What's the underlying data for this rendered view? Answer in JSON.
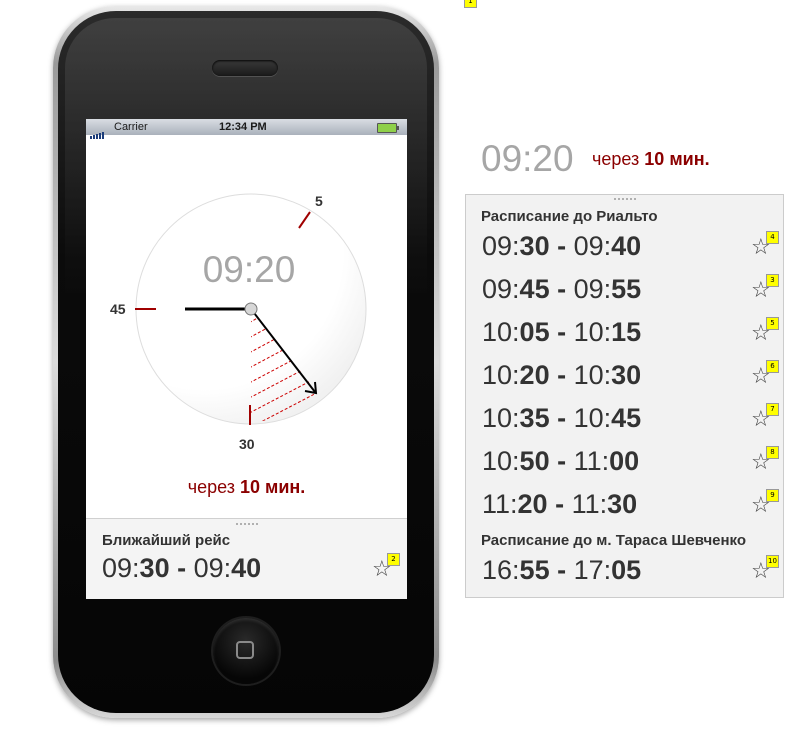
{
  "status_bar": {
    "carrier": "Carrier",
    "time": "12:34 PM"
  },
  "clock": {
    "current_time": "09:20",
    "label_5": "5",
    "label_45": "45",
    "label_30": "30"
  },
  "countdown": {
    "prefix": "через",
    "value": "10 мин."
  },
  "nearest": {
    "title": "Ближайший рейс",
    "dep_hh": "09:",
    "dep_mm": "30",
    "sep": " - ",
    "arr_hh": "09:",
    "arr_mm": "40",
    "badge": "2"
  },
  "top_badge": "1",
  "side": {
    "current_time": "09:20",
    "countdown_prefix": "через",
    "countdown_value": "10 мин."
  },
  "schedules": [
    {
      "title": "Расписание до Риальто",
      "rows": [
        {
          "dep_hh": "09:",
          "dep_mm": "30",
          "arr_hh": "09:",
          "arr_mm": "40",
          "badge": "4"
        },
        {
          "dep_hh": "09:",
          "dep_mm": "45",
          "arr_hh": "09:",
          "arr_mm": "55",
          "badge": "3"
        },
        {
          "dep_hh": "10:",
          "dep_mm": "05",
          "arr_hh": "10:",
          "arr_mm": "15",
          "badge": "5"
        },
        {
          "dep_hh": "10:",
          "dep_mm": "20",
          "arr_hh": "10:",
          "arr_mm": "30",
          "badge": "6"
        },
        {
          "dep_hh": "10:",
          "dep_mm": "35",
          "arr_hh": "10:",
          "arr_mm": "45",
          "badge": "7"
        },
        {
          "dep_hh": "10:",
          "dep_mm": "50",
          "arr_hh": "11:",
          "arr_mm": "00",
          "badge": "8"
        },
        {
          "dep_hh": "11:",
          "dep_mm": "20",
          "arr_hh": "11:",
          "arr_mm": "30",
          "badge": "9"
        }
      ]
    },
    {
      "title": "Расписание до м. Тараса Шевченко",
      "rows": [
        {
          "dep_hh": "16:",
          "dep_mm": "55",
          "arr_hh": "17:",
          "arr_mm": "05",
          "badge": "10"
        }
      ]
    }
  ],
  "row_separator": " - ",
  "icons": {
    "star": "star-outline-icon",
    "home": "home-square-icon",
    "signal": "signal-bars-icon",
    "battery": "battery-icon"
  },
  "colors": {
    "accent_red": "#8b0000",
    "time_gray": "#a6a6a6",
    "panel_bg": "#f2f2f2",
    "badge_yellow": "#ffff00"
  }
}
